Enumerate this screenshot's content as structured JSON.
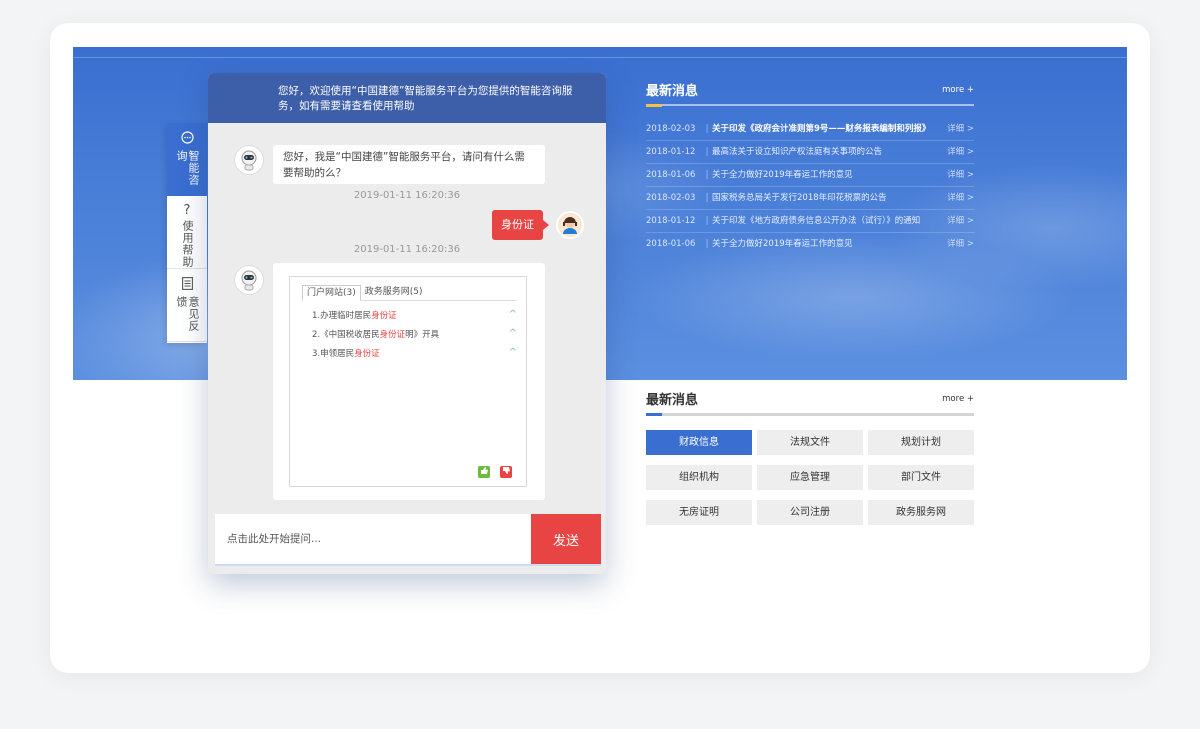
{
  "colors": {
    "accent_blue": "#3a6ed0",
    "send_red": "#e94444",
    "header_blue": "#3d5ea8",
    "gold": "#f5c242"
  },
  "side_tabs": [
    {
      "icon": "chat-bubble-icon",
      "glyph": "💬",
      "label": "智能咨询",
      "active": true
    },
    {
      "icon": "question-icon",
      "glyph": "?",
      "label": "使用帮助",
      "active": false
    },
    {
      "icon": "document-icon",
      "glyph": "📄",
      "label": "意见反馈",
      "active": false
    }
  ],
  "chat": {
    "header": "您好，欢迎使用“中国建德”智能服务平台为您提供的智能咨询服务，如有需要请查看使用帮助",
    "bot_greeting": "您好，我是“中国建德”智能服务平台，请问有什么需要帮助的么？",
    "timestamp_1": "2019-01-11 16:20:36",
    "user_message": "身份证",
    "timestamp_2": "2019-01-11 16:20:36",
    "result_tabs": [
      "门户网站(3)",
      "政务服务网(5)"
    ],
    "results": [
      {
        "prefix": "1.办理临时居民",
        "highlight": "身份证",
        "suffix": ""
      },
      {
        "prefix": "2.《中国税收居民",
        "highlight": "身份证",
        "suffix": "明》开具"
      },
      {
        "prefix": "3.申领居民",
        "highlight": "身份证",
        "suffix": ""
      }
    ],
    "input_placeholder": "点击此处开始提问...",
    "send_label": "发送"
  },
  "news": {
    "title": "最新消息",
    "more": "more +",
    "items": [
      {
        "date": "2018-02-03",
        "title": "关于印发《政府会计准则第9号——财务报表编制和列报》",
        "bold": true,
        "detail": "详细 >"
      },
      {
        "date": "2018-01-12",
        "title": "最高法关于设立知识产权法庭有关事项的公告",
        "bold": false,
        "detail": "详细 >"
      },
      {
        "date": "2018-01-06",
        "title": "关于全力做好2019年春运工作的意见",
        "bold": false,
        "detail": "详细 >"
      },
      {
        "date": "2018-02-03",
        "title": "国家税务总局关于发行2018年印花税票的公告",
        "bold": false,
        "detail": "详细 >"
      },
      {
        "date": "2018-01-12",
        "title": "关于印发《地方政府债务信息公开办法（试行）》的通知",
        "bold": false,
        "detail": "详细 >"
      },
      {
        "date": "2018-01-06",
        "title": "关于全力做好2019年春运工作的意见",
        "bold": false,
        "detail": "详细 >"
      }
    ]
  },
  "categories": {
    "title": "最新消息",
    "more": "more +",
    "items": [
      {
        "label": "财政信息",
        "active": true
      },
      {
        "label": "法规文件",
        "active": false
      },
      {
        "label": "规划计划",
        "active": false
      },
      {
        "label": "组织机构",
        "active": false
      },
      {
        "label": "应急管理",
        "active": false
      },
      {
        "label": "部门文件",
        "active": false
      },
      {
        "label": "无房证明",
        "active": false
      },
      {
        "label": "公司注册",
        "active": false
      },
      {
        "label": "政务服务网",
        "active": false
      }
    ]
  }
}
